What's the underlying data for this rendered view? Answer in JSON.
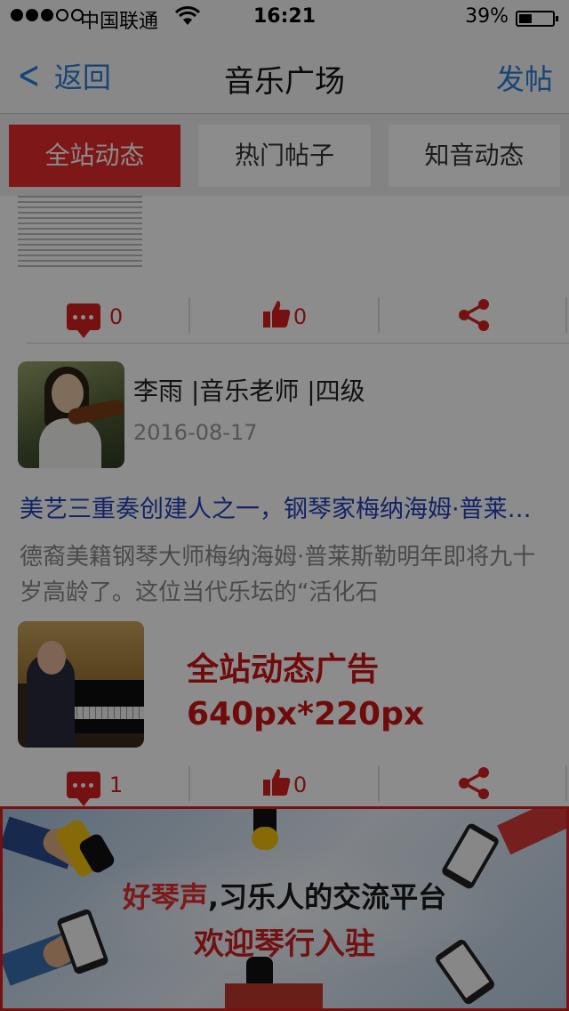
{
  "status": {
    "carrier": "中国联通",
    "time": "16:21",
    "battery": "39%",
    "battery_level": 0.39
  },
  "nav": {
    "back_label": "返回",
    "title": "音乐广场",
    "post_label": "发帖"
  },
  "tabs": [
    {
      "label": "全站动态",
      "active": true
    },
    {
      "label": "热门帖子",
      "active": false
    },
    {
      "label": "知音动态",
      "active": false
    }
  ],
  "posts": [
    {
      "comments": "0",
      "likes": "0"
    },
    {
      "author": "李雨 |音乐老师 |四级",
      "date": "2016-08-17",
      "title": "美艺三重奏创建人之一，钢琴家梅纳海姆·普莱斯勒",
      "body": "德裔美籍钢琴大师梅纳海姆·普莱斯勒明年即将九十岁高龄了。这位当代乐坛的“活化石",
      "ad_line1": "全站动态广告",
      "ad_line2": "640px*220px",
      "comments": "1",
      "likes": "0"
    }
  ],
  "banner": {
    "line1_red": "好琴声",
    "line1_rest": ",习乐人的交流平台",
    "line2": "欢迎琴行入驻"
  },
  "colors": {
    "accent_red": "#e52b2b",
    "link_blue": "#2a7ed8"
  }
}
